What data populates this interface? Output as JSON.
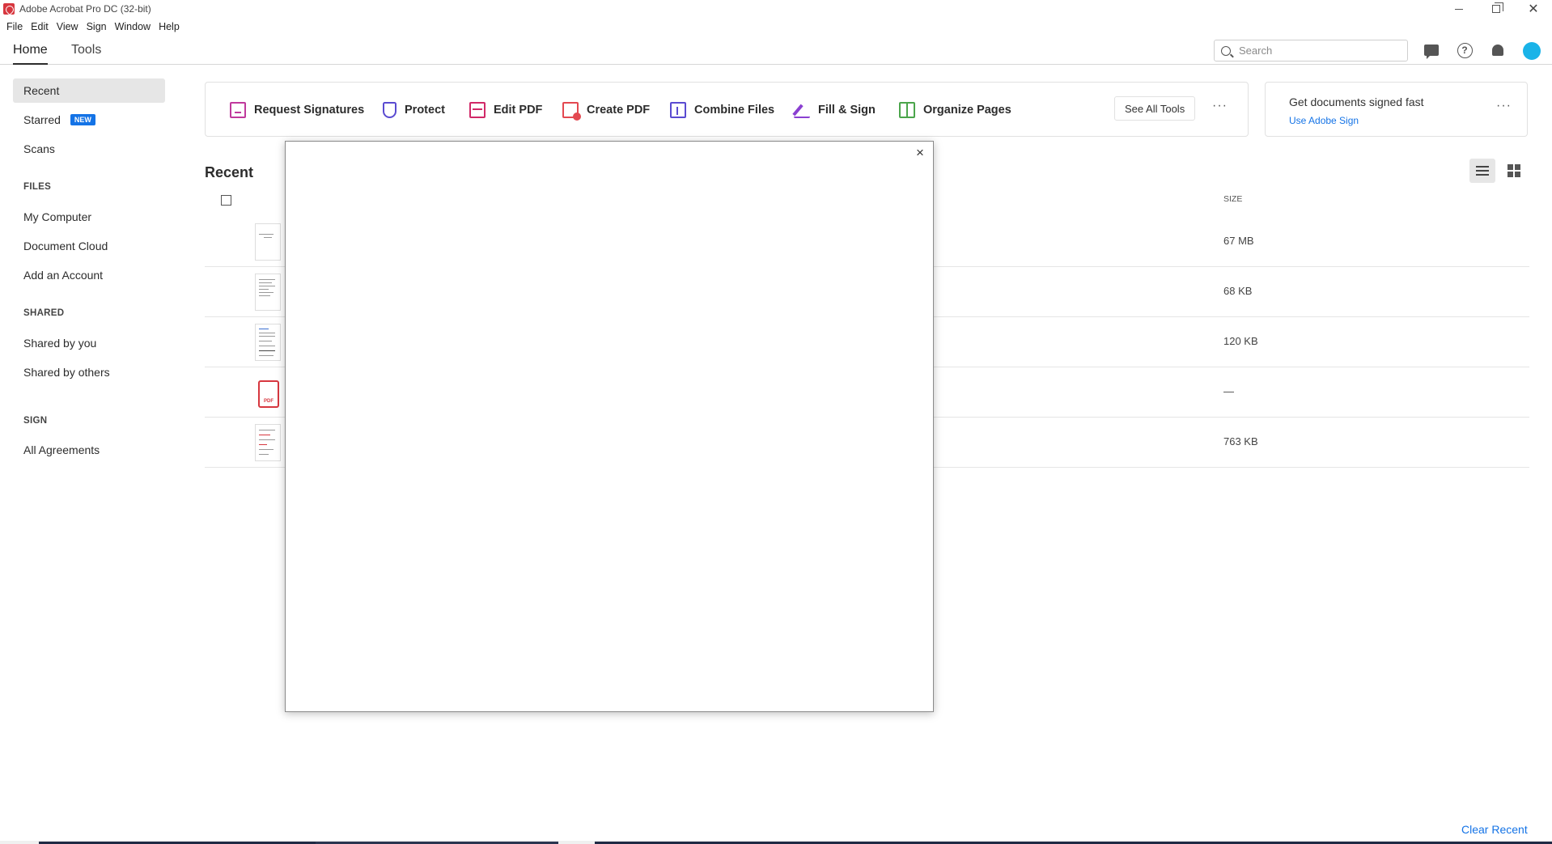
{
  "window": {
    "title": "Adobe Acrobat Pro DC (32-bit)"
  },
  "menu": [
    "File",
    "Edit",
    "View",
    "Sign",
    "Window",
    "Help"
  ],
  "nav": {
    "home": "Home",
    "tools": "Tools",
    "search_placeholder": "Search"
  },
  "sidebar": {
    "recent": "Recent",
    "starred": "Starred",
    "starred_badge": "NEW",
    "scans": "Scans",
    "files_header": "FILES",
    "my_computer": "My Computer",
    "document_cloud": "Document Cloud",
    "add_account": "Add an Account",
    "shared_header": "SHARED",
    "shared_by_you": "Shared by you",
    "shared_by_others": "Shared by others",
    "sign_header": "SIGN",
    "all_agreements": "All Agreements"
  },
  "tools": {
    "request_signatures": "Request Signatures",
    "protect": "Protect",
    "edit_pdf": "Edit PDF",
    "create_pdf": "Create PDF",
    "combine_files": "Combine Files",
    "fill_sign": "Fill & Sign",
    "organize_pages": "Organize Pages",
    "see_all": "See All Tools",
    "more": "···"
  },
  "sign_card": {
    "title": "Get documents signed fast",
    "link": "Use Adobe Sign",
    "more": "···"
  },
  "recent": {
    "title": "Recent",
    "size_header": "SIZE",
    "rows": [
      {
        "size": "67 MB"
      },
      {
        "size": "68 KB"
      },
      {
        "size": "120 KB"
      },
      {
        "size": "—",
        "icon_label": "PDF"
      },
      {
        "size": "763 KB"
      }
    ]
  },
  "footer": {
    "clear_recent": "Clear Recent"
  },
  "modal": {
    "close": "×"
  },
  "colors": {
    "accent": "#1473e6",
    "acrobat_red": "#d7373f",
    "new_badge": "#1473e6"
  }
}
